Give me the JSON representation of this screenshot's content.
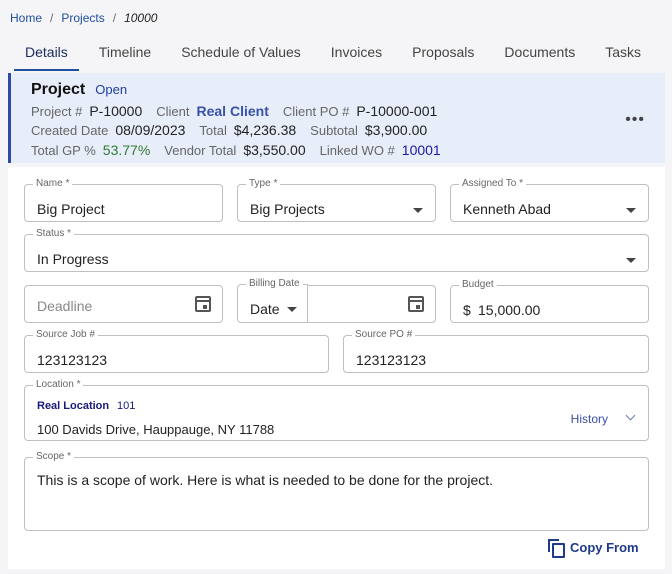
{
  "breadcrumb": {
    "home": "Home",
    "projects": "Projects",
    "current": "10000"
  },
  "tabs": [
    "Details",
    "Timeline",
    "Schedule of Values",
    "Invoices",
    "Proposals",
    "Documents",
    "Tasks"
  ],
  "summary": {
    "title": "Project",
    "status": "Open",
    "project_no_label": "Project #",
    "project_no": "P-10000",
    "client_label": "Client",
    "client": "Real Client",
    "client_po_label": "Client PO #",
    "client_po": "P-10000-001",
    "created_label": "Created Date",
    "created": "08/09/2023",
    "total_label": "Total",
    "total": "$4,236.38",
    "subtotal_label": "Subtotal",
    "subtotal": "$3,900.00",
    "gp_label": "Total GP %",
    "gp": "53.77%",
    "vendor_label": "Vendor Total",
    "vendor": "$3,550.00",
    "wo_label": "Linked WO #",
    "wo": "10001",
    "more": "•••"
  },
  "form": {
    "name_label": "Name *",
    "name": "Big Project",
    "type_label": "Type *",
    "type": "Big Projects",
    "assigned_label": "Assigned To *",
    "assigned": "Kenneth Abad",
    "status_label": "Status *",
    "status": "In Progress",
    "deadline_placeholder": "Deadline",
    "billing_label": "Billing Date",
    "billing_mode": "Date",
    "budget_label": "Budget",
    "budget_currency": "$",
    "budget": "15,000.00",
    "source_job_label": "Source Job #",
    "source_job": "123123123",
    "source_po_label": "Source PO #",
    "source_po": "123123123",
    "location_label": "Location *",
    "location_name": "Real Location",
    "location_id": "101",
    "location_address": "100 Davids Drive, Hauppauge, NY 11788",
    "history_label": "History",
    "scope_label": "Scope *",
    "scope": "This is a scope of work. Here is what is needed to be done for the project."
  },
  "copy_from_label": "Copy From"
}
